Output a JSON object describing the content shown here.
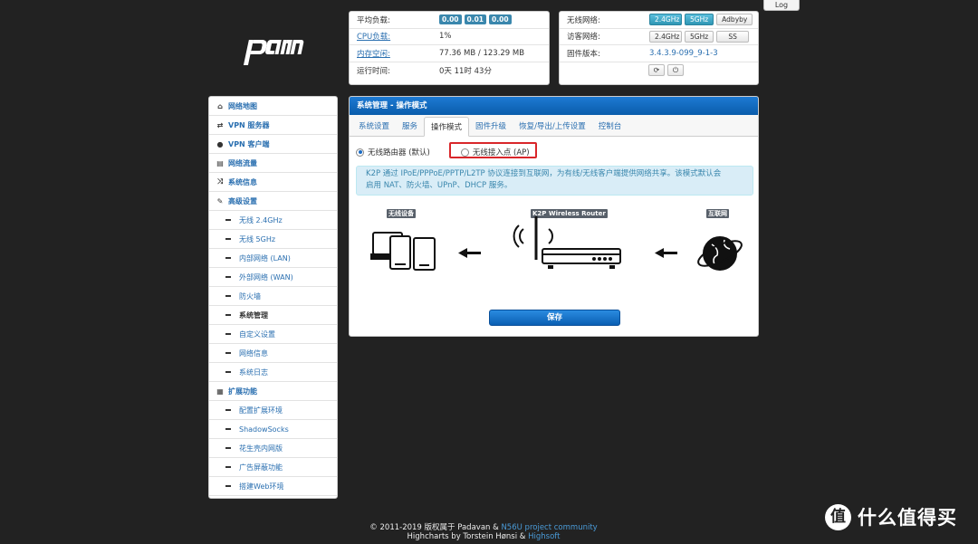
{
  "header": {
    "log_button": "Log"
  },
  "status_left": {
    "rows": [
      {
        "label": "平均负载:",
        "badges": [
          "0.00",
          "0.01",
          "0.00"
        ]
      },
      {
        "label": "CPU负载:",
        "value": "1%"
      },
      {
        "label": "内存空闲:",
        "value": "77.36 MB / 123.29 MB"
      },
      {
        "label": "运行时间:",
        "value": "0天 11时 43分"
      }
    ]
  },
  "status_right": {
    "wireless_label": "无线网络:",
    "wireless_buttons": [
      "2.4GHz",
      "5GHz",
      "Adbyby"
    ],
    "guest_label": "访客网络:",
    "guest_buttons": [
      "2.4GHz",
      "5GHz",
      "SS"
    ],
    "firmware_label": "固件版本:",
    "firmware_value": "3.4.3.9-099_9-1-3"
  },
  "sidebar": {
    "items": [
      {
        "label": "网络地图",
        "icon": "home-icon"
      },
      {
        "label": "VPN 服务器",
        "icon": "exchange-icon"
      },
      {
        "label": "VPN 客户端",
        "icon": "globe-icon"
      },
      {
        "label": "网络流量",
        "icon": "monitor-icon"
      },
      {
        "label": "系统信息",
        "icon": "shuffle-icon"
      },
      {
        "label": "高级设置",
        "icon": "wrench-icon"
      }
    ],
    "advanced_sub": [
      "无线 2.4GHz",
      "无线 5GHz",
      "内部网络 (LAN)",
      "外部网络 (WAN)",
      "防火墙",
      "系统管理",
      "自定义设置",
      "网络信息",
      "系统日志"
    ],
    "ext_label": "扩展功能",
    "ext_sub": [
      "配置扩展环境",
      "ShadowSocks",
      "花生壳内网版",
      "广告屏蔽功能",
      "搭建Web环境"
    ]
  },
  "panel": {
    "title": "系统管理 - 操作模式",
    "tabs": [
      "系统设置",
      "服务",
      "操作模式",
      "固件升级",
      "恢复/导出/上传设置",
      "控制台"
    ],
    "radio_router": "无线路由器 (默认)",
    "radio_ap": "无线接入点 (AP)",
    "info_line1": "K2P 通过 IPoE/PPPoE/PPTP/L2TP 协议连接到互联网，为有线/无线客户端提供网络共享。该模式默认会",
    "info_line2": "启用 NAT、防火墙、UPnP、DHCP 服务。",
    "tag_devices": "无线设备",
    "tag_router": "K2P Wireless Router",
    "tag_internet": "互联网",
    "save_button": "保存"
  },
  "footer": {
    "line1_prefix": "© 2011-2019 版权属于 Padavan &",
    "line1_link": "N56U project community",
    "line2_prefix": "Highcharts by Torstein Hønsi &",
    "line2_link": "Highsoft"
  },
  "watermark": {
    "circle": "值",
    "text": "什么值得买"
  }
}
